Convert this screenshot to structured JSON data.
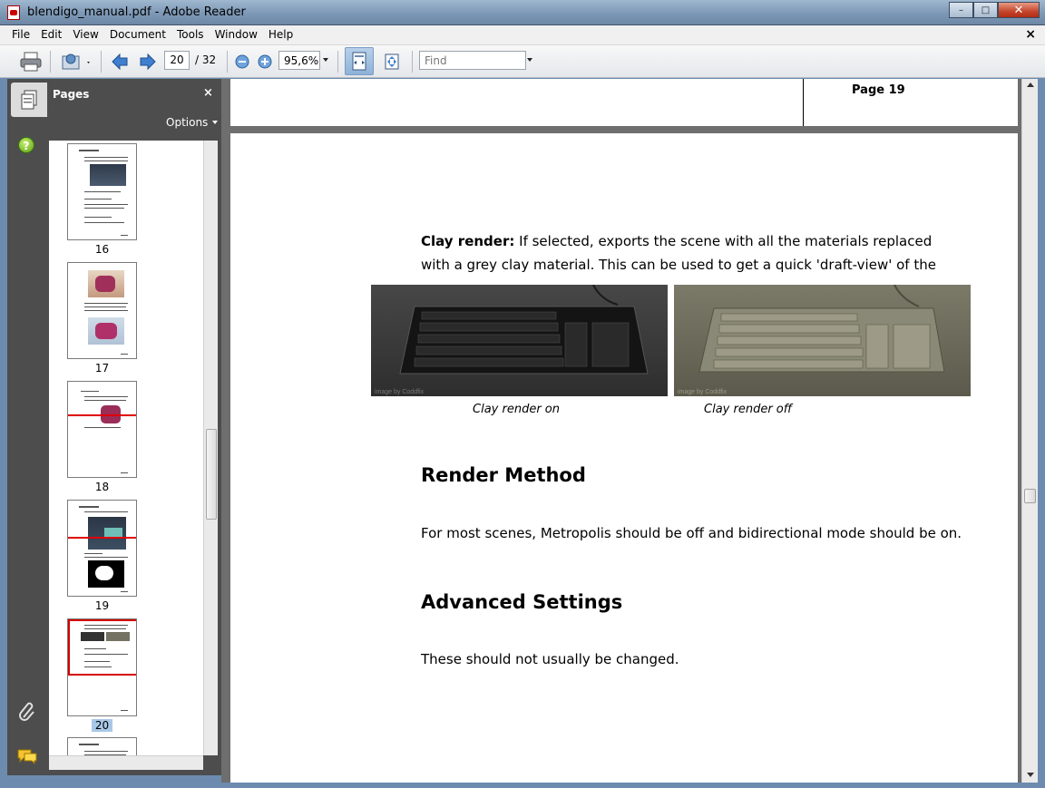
{
  "window": {
    "title": "blendigo_manual.pdf - Adobe Reader",
    "minimize": "–",
    "maximize": "□",
    "close": "✕"
  },
  "menu": {
    "items": [
      "File",
      "Edit",
      "View",
      "Document",
      "Tools",
      "Window",
      "Help"
    ],
    "doc_close": "×"
  },
  "toolbar": {
    "page_current": "20",
    "page_total": "/ 32",
    "zoom": "95,6%",
    "find_placeholder": "Find",
    "icons": [
      "print-icon",
      "share-icon",
      "previous-page-icon",
      "next-page-icon",
      "zoom-out-icon",
      "zoom-in-icon",
      "fit-width-icon",
      "fit-page-icon"
    ]
  },
  "panel": {
    "title": "Pages",
    "close": "×",
    "options": "Options",
    "thumbnails": [
      {
        "num": "16",
        "selected": false
      },
      {
        "num": "17",
        "selected": false
      },
      {
        "num": "18",
        "selected": false
      },
      {
        "num": "19",
        "selected": false
      },
      {
        "num": "20",
        "selected": true
      }
    ]
  },
  "rail": {
    "help": "?"
  },
  "document": {
    "prev_page_label": "Page 19",
    "clay_bold": "Clay render:",
    "clay_text": " If selected, exports the scene with all the materials replaced with a grey clay material. This can be used to get a quick 'draft-view' of the scene.",
    "caption_on": "Clay render on",
    "caption_off": "Clay render off",
    "image_credit": "image by Coddfix",
    "heading_render": "Render Method",
    "para_render": "For most scenes, Metropolis should be off and bidirectional mode should be on.",
    "heading_advanced": "Advanced Settings",
    "para_advanced": "These should not usually be changed."
  }
}
